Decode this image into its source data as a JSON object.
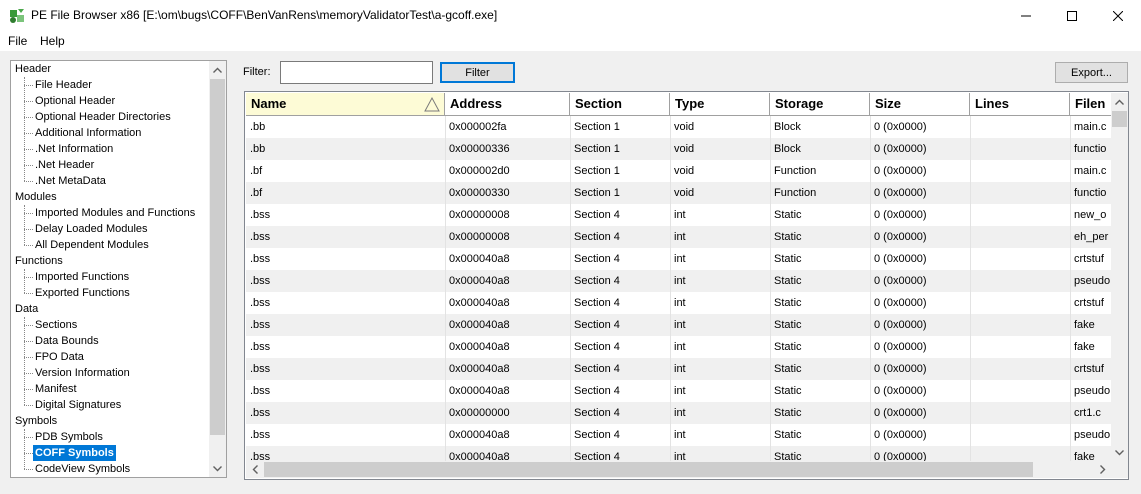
{
  "window": {
    "title": "PE File Browser x86 [E:\\om\\bugs\\COFF\\BenVanRens\\memoryValidatorTest\\a-gcoff.exe]",
    "app_icon": "pe-browser-icon",
    "controls": [
      "minimize-icon",
      "maximize-icon",
      "close-icon"
    ]
  },
  "menu": {
    "file": "File",
    "help": "Help"
  },
  "tree": {
    "header": "Header",
    "header_items": [
      "File Header",
      "Optional Header",
      "Optional Header Directories",
      "Additional Information",
      ".Net Information",
      ".Net Header",
      ".Net MetaData"
    ],
    "modules": "Modules",
    "modules_items": [
      "Imported Modules and Functions",
      "Delay Loaded Modules",
      "All Dependent Modules"
    ],
    "functions": "Functions",
    "functions_items": [
      "Imported Functions",
      "Exported Functions"
    ],
    "data": "Data",
    "data_items": [
      "Sections",
      "Data Bounds",
      "FPO Data",
      "Version Information",
      "Manifest",
      "Digital Signatures"
    ],
    "symbols": "Symbols",
    "symbols_items": [
      "PDB Symbols",
      "COFF Symbols",
      "CodeView Symbols"
    ],
    "selected": "COFF Symbols"
  },
  "toolbar": {
    "filter_label": "Filter:",
    "filter_value": "",
    "filter_button": "Filter",
    "export_button": "Export..."
  },
  "grid": {
    "columns": [
      "Name",
      "Address",
      "Section",
      "Type",
      "Storage",
      "Size",
      "Lines",
      "Filen"
    ],
    "sorted_column": "Name",
    "rows": [
      [
        ".bb",
        "0x000002fa",
        "Section 1",
        "void",
        "Block",
        "0 (0x0000)",
        "",
        "main.c"
      ],
      [
        ".bb",
        "0x00000336",
        "Section 1",
        "void",
        "Block",
        "0 (0x0000)",
        "",
        "functio"
      ],
      [
        ".bf",
        "0x000002d0",
        "Section 1",
        "void",
        "Function",
        "0 (0x0000)",
        "",
        "main.c"
      ],
      [
        ".bf",
        "0x00000330",
        "Section 1",
        "void",
        "Function",
        "0 (0x0000)",
        "",
        "functio"
      ],
      [
        ".bss",
        "0x00000008",
        "Section 4",
        "int",
        "Static",
        "0 (0x0000)",
        "",
        "new_o"
      ],
      [
        ".bss",
        "0x00000008",
        "Section 4",
        "int",
        "Static",
        "0 (0x0000)",
        "",
        "eh_per"
      ],
      [
        ".bss",
        "0x000040a8",
        "Section 4",
        "int",
        "Static",
        "0 (0x0000)",
        "",
        "crtstuf"
      ],
      [
        ".bss",
        "0x000040a8",
        "Section 4",
        "int",
        "Static",
        "0 (0x0000)",
        "",
        "pseudo"
      ],
      [
        ".bss",
        "0x000040a8",
        "Section 4",
        "int",
        "Static",
        "0 (0x0000)",
        "",
        "crtstuf"
      ],
      [
        ".bss",
        "0x000040a8",
        "Section 4",
        "int",
        "Static",
        "0 (0x0000)",
        "",
        "fake"
      ],
      [
        ".bss",
        "0x000040a8",
        "Section 4",
        "int",
        "Static",
        "0 (0x0000)",
        "",
        "fake"
      ],
      [
        ".bss",
        "0x000040a8",
        "Section 4",
        "int",
        "Static",
        "0 (0x0000)",
        "",
        "crtstuf"
      ],
      [
        ".bss",
        "0x000040a8",
        "Section 4",
        "int",
        "Static",
        "0 (0x0000)",
        "",
        "pseudo"
      ],
      [
        ".bss",
        "0x00000000",
        "Section 4",
        "int",
        "Static",
        "0 (0x0000)",
        "",
        "crt1.c"
      ],
      [
        ".bss",
        "0x000040a8",
        "Section 4",
        "int",
        "Static",
        "0 (0x0000)",
        "",
        "pseudo"
      ],
      [
        ".bss",
        "0x000040a8",
        "Section 4",
        "int",
        "Static",
        "0 (0x0000)",
        "",
        "fake"
      ]
    ]
  },
  "colors": {
    "selection": "#0078d7",
    "sorted_header": "#fdfbd6",
    "alt_row": "#f0f0f0"
  }
}
